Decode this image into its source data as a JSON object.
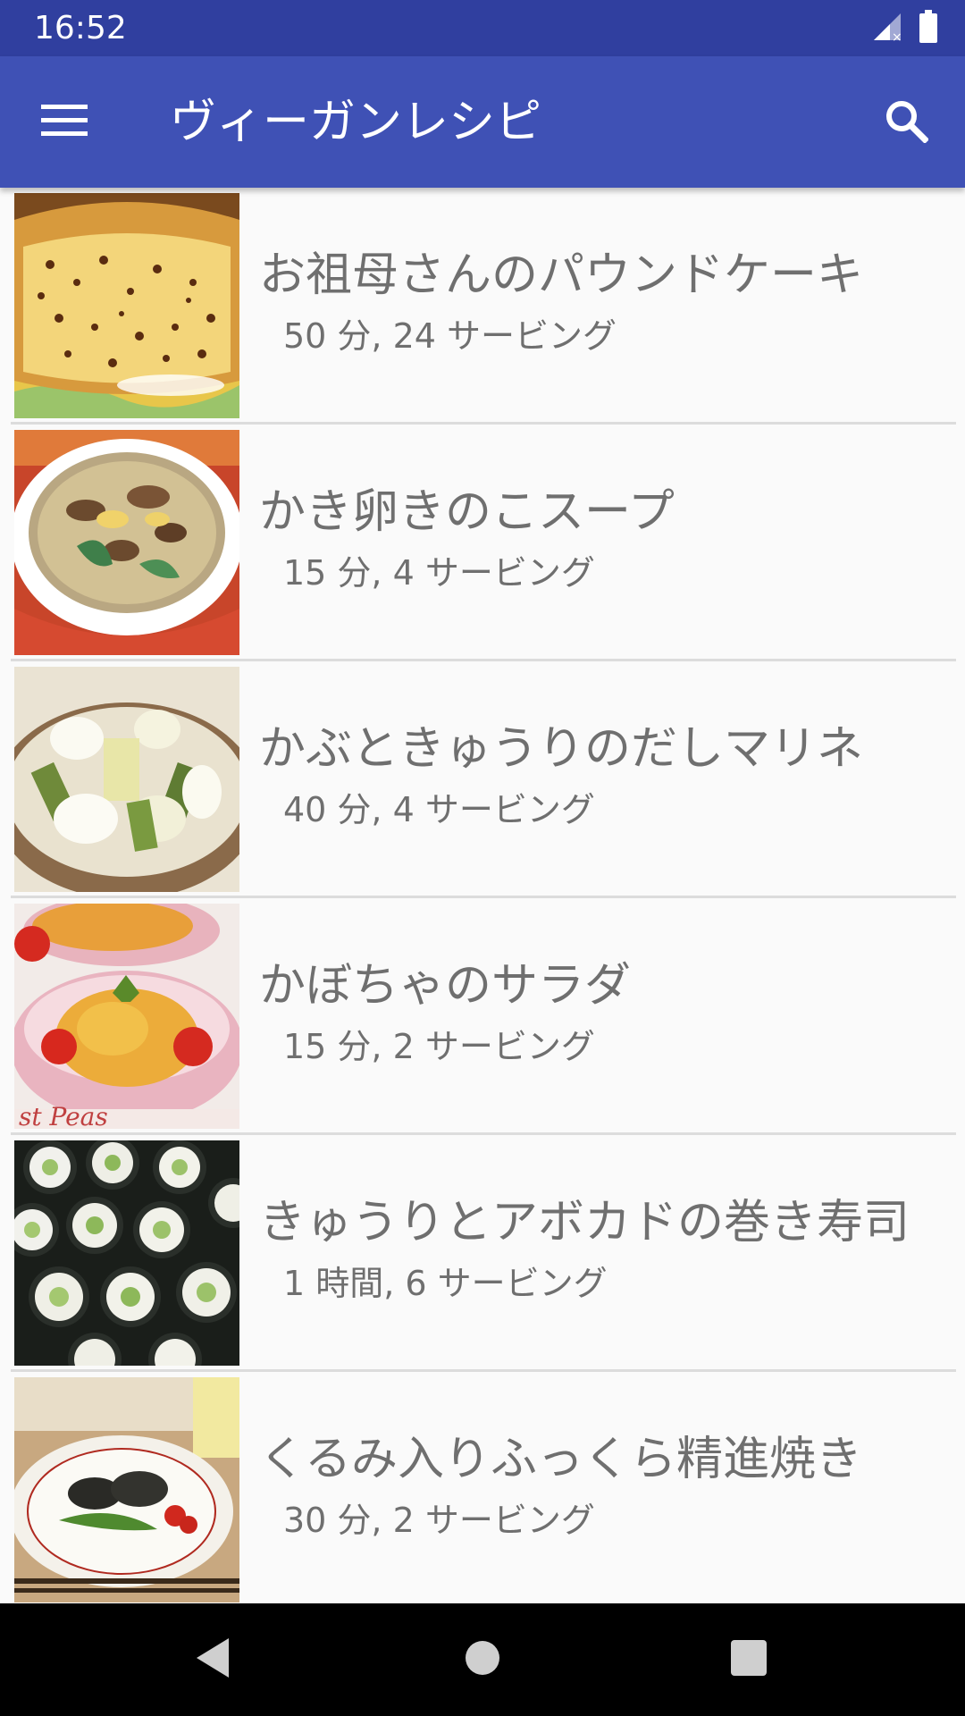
{
  "status_bar": {
    "time": "16:52",
    "icons": [
      "signal-x-icon",
      "battery-icon"
    ]
  },
  "app_bar": {
    "title": "ヴィーガンレシピ",
    "menu_icon": "hamburger-menu-icon",
    "search_icon": "search-icon",
    "color": "#3f51b5",
    "status_color": "#303f9f"
  },
  "recipes": [
    {
      "title": "お祖母さんのパウンドケーキ",
      "meta": "50 分, 24 サービング",
      "image": "pound-cake-photo"
    },
    {
      "title": "かき卵きのこスープ",
      "meta": "15 分, 4 サービング",
      "image": "mushroom-egg-soup-photo"
    },
    {
      "title": "かぶときゅうりのだしマリネ",
      "meta": "40 分, 4 サービング",
      "image": "turnip-cucumber-marinade-photo"
    },
    {
      "title": "かぼちゃのサラダ",
      "meta": "15 分, 2 サービング",
      "image": "pumpkin-salad-photo"
    },
    {
      "title": "きゅうりとアボカドの巻き寿司",
      "meta": "1 時間, 6 サービング",
      "image": "cucumber-avocado-sushi-photo"
    },
    {
      "title": "くるみ入りふっくら精進焼き",
      "meta": "30 分, 2 サービング",
      "image": "walnut-shojin-yaki-photo"
    }
  ],
  "nav_bar": {
    "back_icon": "back-triangle-icon",
    "home_icon": "home-circle-icon",
    "recents_icon": "recents-square-icon"
  }
}
